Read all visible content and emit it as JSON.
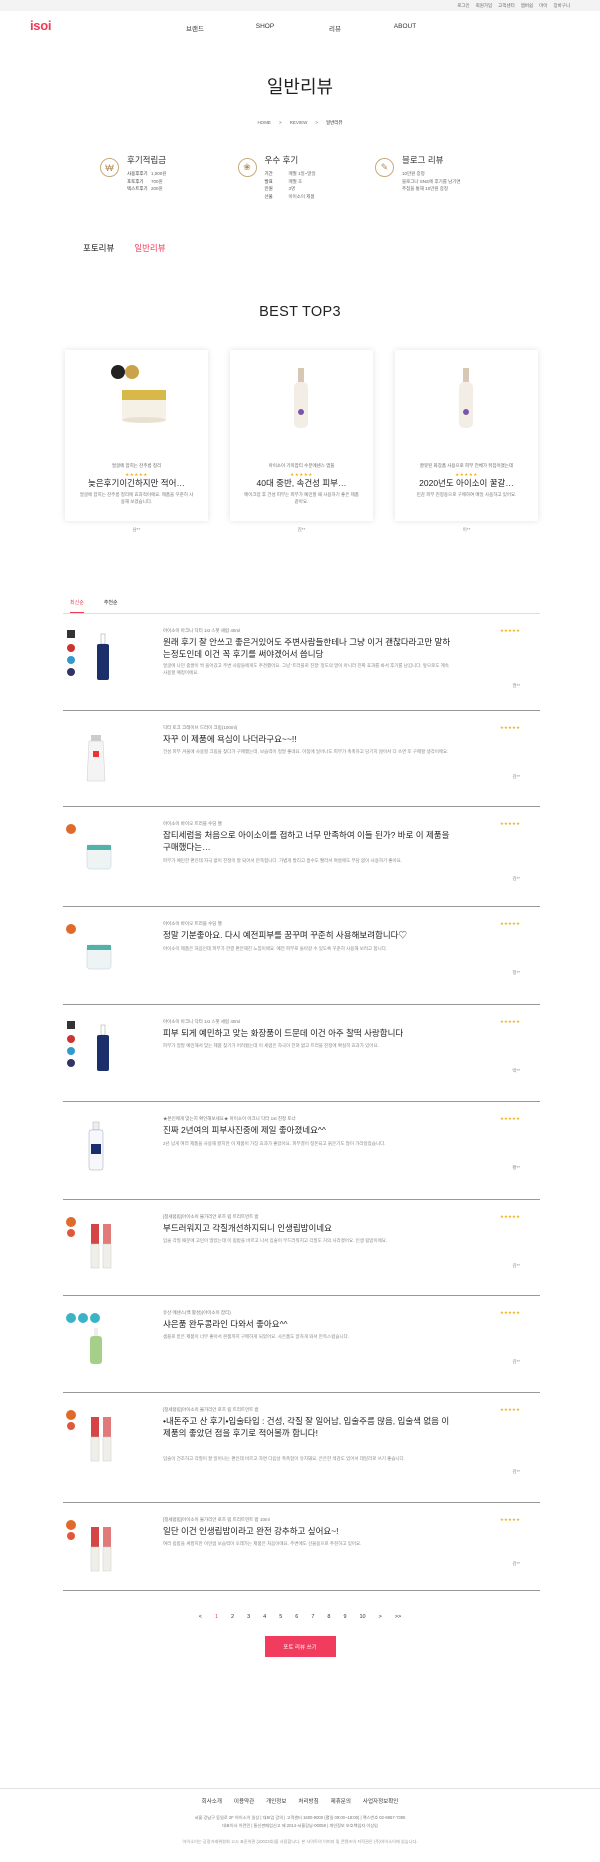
{
  "topbar": {
    "links": [
      "로그인",
      "회원가입",
      "고객센터",
      "멤버쉽",
      "마이",
      "장바구니"
    ]
  },
  "brand": {
    "logo": "isoi",
    "accent": "#ef3b54"
  },
  "nav": {
    "items": [
      "브랜드",
      "SHOP",
      "리뷰",
      "ABOUT"
    ]
  },
  "page": {
    "title": "일반리뷰"
  },
  "breadcrumb": {
    "items": [
      "HOME",
      ">",
      "REVIEW",
      ">",
      "일반리뷰"
    ]
  },
  "info": [
    {
      "icon": "coin-icon",
      "title": "후기적립금",
      "rows": [
        [
          "사용후후기",
          "1,000원"
        ],
        [
          "포토후기",
          "700원"
        ],
        [
          "텍스트후기",
          "200원"
        ]
      ]
    },
    {
      "icon": "gift-icon",
      "title": "우수 후기",
      "rows": [
        [
          "기간",
          "매월 1일~말일"
        ],
        [
          "발표",
          "매월 초"
        ],
        [
          "인원",
          "3명"
        ],
        [
          "선물",
          "아이소이 제품"
        ]
      ]
    },
    {
      "icon": "blog-icon",
      "title": "블로그 리뷰",
      "rows": [
        [
          "10만원 증정",
          ""
        ],
        [
          "블로그나 SNS에 후기를 남기면",
          ""
        ],
        [
          "추첨을 통해 10만원 증정",
          ""
        ]
      ]
    }
  ],
  "type_tabs": [
    "포토리뷰",
    "일반리뷰"
  ],
  "best": {
    "title": "BEST TOP3",
    "items": [
      {
        "sub": "얼굴에 잡히는 잔주름 정리",
        "name": "늦은후기이긴하지만 적어…",
        "desc": "얼굴에 잡히는 잔주름 정리에 효과적이에요. 제품을 꾸준히 사용해 보겠습니다.",
        "author": "남**"
      },
      {
        "sub": "아이소이 기미잡티 수분에센스 앰플",
        "name": "40대 중반, 속건성 피부…",
        "desc": "메이크업 후 건성 피부는 피부가 예민할 때 사용하기 좋은 제품 같아요.",
        "author": "김**"
      },
      {
        "sub": "잘못된 화장품 사용으로 피부 전체가 뒤집어졌는데",
        "name": "2020년도 아이소이 꿀갈…",
        "desc": "민감 피부 진정용으로 구매하여 매일 사용하고 있어요.",
        "author": "이**"
      }
    ]
  },
  "sort_tabs": [
    "최신순",
    "추천순"
  ],
  "reviews": [
    {
      "option": "아이소이 아크니 닥터 1st 스팟 세럼 40ml",
      "title": "원래 후기 잘 안쓰고 좋은거있어도 주변사람들한테나 그냥 이거 괜찮다라고만 말하는정도인데 이건 꼭 후기를 써야겠어서 씁니당",
      "body": "얼굴에 나던 좁쌀이 싹 들어갔고 주변 사람들에게도 추천했어요. 그냥 '트러블로 진정' 정도의 말이 아니라 진짜 효과를 봐서 후기를 남깁니다. 앞으로도 계속 사용할 예정이에요.",
      "author": "권**"
    },
    {
      "option": "닥터 토크 크레이브 드라이 크림(100ml)",
      "title": "자꾸 이 제품에 욕심이 나더라구요~~!!",
      "body": "건성 피부 겨울에 사용할 크림을 찾다가 구매했는데, 보습력이 정말 좋네요. 아침에 일어나도 피부가 촉촉하고 당기지 않아서 다 쓰면 또 구매할 생각이에요.",
      "author": "김**"
    },
    {
      "option": "아이소이 바이오 트러블 수딩 젤",
      "title": "잡티세럼을 처음으로 아이소이를 접하고 너무 만족하여 이들 된가? 바로 이 제품을 구매했다는…",
      "body": "피부가 예민한 편인데 자극 없이 진정이 잘 되어서 만족합니다. 가볍게 발리고 흡수도 빨라서 여름에도 부담 없이 사용하기 좋아요.",
      "author": "김**"
    },
    {
      "option": "아이소이 바이오 트러블 수딩 젤",
      "title": "정말 기분좋아요. 다시 예전피부를 꿈꾸며 꾸준히 사용해보려합니다♡",
      "body": "아이소이 제품은 처음인데 피부가 한결 편안해진 느낌이에요. 예전 피부로 돌아갈 수 있도록 꾸준히 사용해 보려고 합니다.",
      "author": "정**"
    },
    {
      "option": "아이소이 아크니 닥터 1st 스팟 세럼 40ml",
      "title": "피부 되게 예민하고 맞는 화장품이 드문데 이건 아주 찰떡 사랑합니다",
      "body": "피부가 정말 예민해서 맞는 제품 찾기가 어려웠는데 이 세럼은 자극이 전혀 없고 트러블 진정에 확실히 효과가 있어요.",
      "author": "박**"
    },
    {
      "option": "★본인에게 맞는지 확인해보세요★ 아이소이 아크니 닥터 1st 진정 토너",
      "title": "진짜 2년여의 피부사진중에 제일 좋아졌네요^^",
      "body": "2년 넘게 여러 제품을 사용해 봤지만 이 제품이 가장 효과가 좋았어요. 피부결이 정돈되고 붉은기도 많이 가라앉았습니다.",
      "author": "황**"
    },
    {
      "option": "[정세럼립]아이소이 불가리안 로즈 립 트리트먼트 밤",
      "title": "부드러워지고 각질개선하지되니 인생립밤이네요",
      "body": "입술 각질 때문에 고민이 많았는데 이 립밤을 바르고 나서 입술이 부드러워지고 각질도 거의 사라졌어요. 인생 립밤이에요.",
      "author": "김**"
    },
    {
      "option": "유산 에센스(백 활성)(아이소이 잡티)",
      "title": "샤은품 완두콩라인 다와서 좋아요^^",
      "body": "샘플로 받은 제품이 너무 좋아서 본품까지 구매하게 되었어요. 사은품도 알차게 와서 만족스럽습니다.",
      "author": "김**"
    },
    {
      "option": "[정세럼립]아이소이 불가리안 로즈 립 트리트먼트 밤",
      "title": "•내돈주고 산 후기•입술타입 : 건성, 각질 잘 일어남, 입술주름 많음, 입술색 없음 이 제품의 좋았던 점을 후기로 적어볼까 합니다!",
      "body": "입술이 건조하고 각질이 잘 일어나는 편인데 바르고 자면 다음날 촉촉함이 유지돼요. 은은한 색감도 있어서 데일리로 쓰기 좋습니다.",
      "author": "김**"
    },
    {
      "option": "[정세럼립]아이소이 불가리안 로즈 립 트리트먼트 밤 10ml",
      "title": "일단 이건 인생립밤이라고 완전 강추하고 싶어요~!",
      "body": "여러 립밤을 써봤지만 이만큼 보습력이 오래가는 제품은 처음이에요. 주변에도 선물용으로 추천하고 있어요.",
      "author": "김**"
    }
  ],
  "pagination": [
    "<",
    "1",
    "2",
    "3",
    "4",
    "5",
    "6",
    "7",
    "8",
    "9",
    "10",
    ">",
    ">>"
  ],
  "write_button": "포토 리뷰 쓰기",
  "footer": {
    "links": [
      "회사소개",
      "이용약관",
      "개인정보",
      "처리방침",
      "제휴문의",
      "사업자정보확인"
    ],
    "line1": "서울 강남구 등일로 2F 아이소이 일상 | 대표업 강의 | 고객센터 1600-9000 (평일 09:00~18:00) | 팩스번호 02-6957-7390",
    "line2": "대표이사 이런민 | 통신판매업신고 제 2014-서울강남-00058 | 개인정보 보호책임자 이상임",
    "copy": "아이소이는 공정거래위원회 고시 표준약관 (10023호)을 사용합니다. 본 사이트의 이미지 및 콘텐츠의 저작권은 (주)아이소이에 있습니다."
  }
}
